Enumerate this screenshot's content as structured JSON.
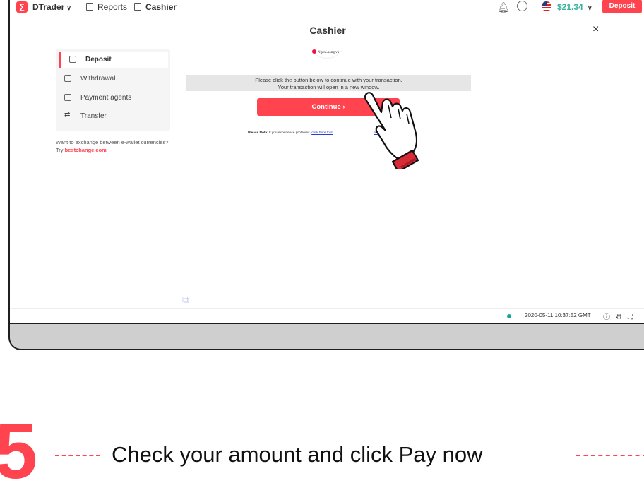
{
  "header": {
    "app_name": "DTrader",
    "nav_reports": "Reports",
    "nav_cashier": "Cashier",
    "balance": "$21.34",
    "deposit_button": "Deposit"
  },
  "modal": {
    "title": "Cashier",
    "close": "×"
  },
  "sidebar": {
    "items": [
      {
        "label": "Deposit",
        "active": true
      },
      {
        "label": "Withdrawal"
      },
      {
        "label": "Payment agents"
      },
      {
        "label": "Transfer"
      }
    ],
    "exchange_text": "Want to exchange between e-wallet currencies? Try",
    "exchange_link": "bestchange.com"
  },
  "content": {
    "brand_logo_text": "NganLuong.vn",
    "message_line1": "Please click the button below to continue with your transaction.",
    "message_line2": "Your transaction will open in a new window.",
    "continue_label": "Continue",
    "note_label": "Please Note",
    "note_text": ": If you experience problems,",
    "note_link": "click here to st",
    "note_tail": "ain."
  },
  "footer": {
    "timestamp": "2020-05-11 10:37:52 GMT"
  },
  "step": {
    "number": "5",
    "text": "Check your amount and click Pay now"
  },
  "colors": {
    "brand_red": "#ff444f",
    "balance_green": "#39b19d"
  }
}
